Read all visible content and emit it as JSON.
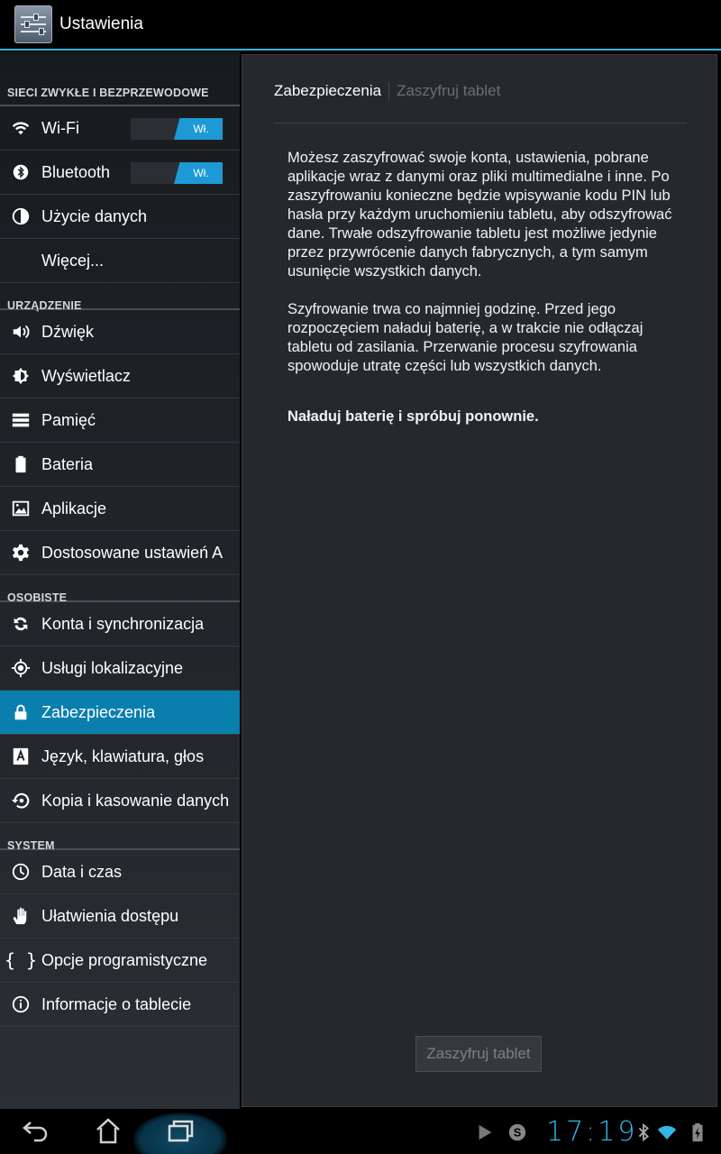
{
  "app": {
    "title": "Ustawienia"
  },
  "sidebar": {
    "sections": [
      {
        "header": "SIECI ZWYKŁE I BEZPRZEWODOWE",
        "items": [
          {
            "label": "Wi-Fi",
            "icon": "wifi-icon",
            "toggle": "Wł."
          },
          {
            "label": "Bluetooth",
            "icon": "bluetooth-icon",
            "toggle": "Wł."
          },
          {
            "label": "Użycie danych",
            "icon": "data-usage-icon"
          },
          {
            "label": "Więcej...",
            "icon": ""
          }
        ]
      },
      {
        "header": "URZĄDZENIE",
        "items": [
          {
            "label": "Dźwięk",
            "icon": "sound-icon"
          },
          {
            "label": "Wyświetlacz",
            "icon": "display-icon"
          },
          {
            "label": "Pamięć",
            "icon": "storage-icon"
          },
          {
            "label": "Bateria",
            "icon": "battery-icon"
          },
          {
            "label": "Aplikacje",
            "icon": "apps-icon"
          },
          {
            "label": "Dostosowane ustawień A",
            "icon": "gear-icon"
          }
        ]
      },
      {
        "header": "OSOBISTE",
        "items": [
          {
            "label": "Konta i synchronizacja",
            "icon": "sync-icon"
          },
          {
            "label": "Usługi lokalizacyjne",
            "icon": "location-icon"
          },
          {
            "label": "Zabezpieczenia",
            "icon": "lock-icon",
            "active": true
          },
          {
            "label": "Język, klawiatura, głos",
            "icon": "language-icon"
          },
          {
            "label": "Kopia i kasowanie danych",
            "icon": "backup-icon"
          }
        ]
      },
      {
        "header": "SYSTEM",
        "items": [
          {
            "label": "Data i czas",
            "icon": "clock-icon"
          },
          {
            "label": "Ułatwienia dostępu",
            "icon": "accessibility-hand-icon"
          },
          {
            "label": "Opcje programistyczne",
            "icon": "braces-icon"
          },
          {
            "label": "Informacje o tablecie",
            "icon": "info-icon"
          }
        ]
      }
    ]
  },
  "main": {
    "breadcrumb_current": "Zabezpieczenia",
    "breadcrumb_sub": "Zaszyfruj tablet",
    "paragraph1": "Możesz zaszyfrować swoje konta, ustawienia, pobrane aplikacje wraz z danymi oraz pliki multimedialne i inne. Po zaszyfrowaniu konieczne będzie wpisywanie kodu PIN lub hasła przy każdym uruchomieniu tabletu, aby odszyfrować dane. Trwałe odszyfrowanie tabletu jest możliwe jedynie przez przywrócenie danych fabrycznych, a tym samym usunięcie wszystkich danych.",
    "paragraph2": "Szyfrowanie trwa co najmniej godzinę. Przed jego rozpoczęciem naładuj baterię, a w trakcie nie odłączaj tabletu od zasilania. Przerwanie procesu szyfrowania spowoduje utratę części lub wszystkich danych.",
    "warning": "Naładuj baterię i spróbuj ponownie.",
    "encrypt_button": "Zaszyfruj tablet"
  },
  "statusbar": {
    "time": "17:19"
  },
  "colors": {
    "accent": "#33b5e5",
    "active_item": "#0a7fae"
  }
}
